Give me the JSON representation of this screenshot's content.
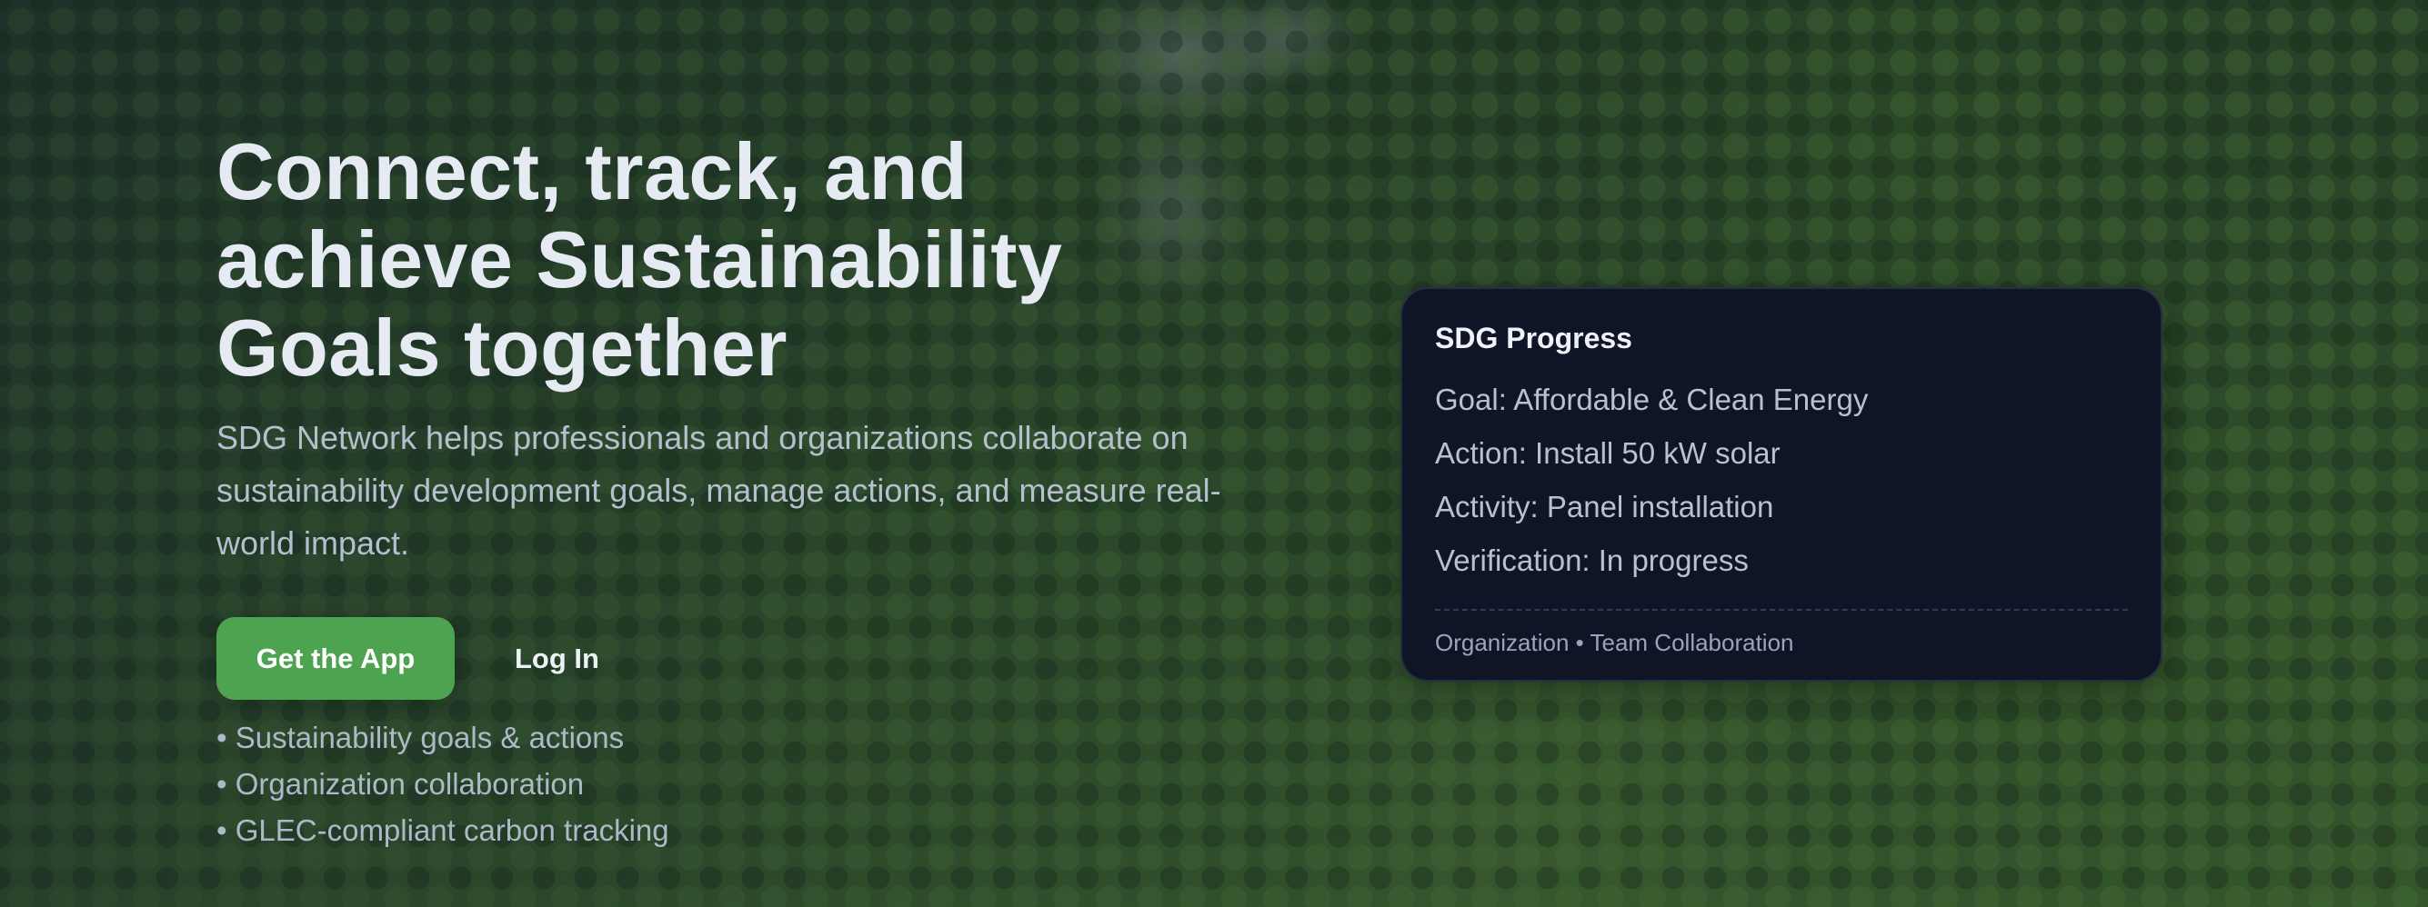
{
  "hero": {
    "headline": "Connect, track, and achieve Sustainability Goals together",
    "description": "SDG Network helps professionals and organizations collaborate on sustainability development goals, manage actions, and measure real-world impact.",
    "primary_button": "Get the App",
    "secondary_button": "Log In",
    "features": [
      "Sustainability goals & actions",
      "Organization collaboration",
      "GLEC-compliant carbon tracking"
    ]
  },
  "card": {
    "title": "SDG Progress",
    "rows": [
      "Goal: Affordable & Clean Energy",
      "Action: Install 50 kW solar",
      "Activity: Panel installation",
      "Verification: In progress"
    ],
    "footer": "Organization • Team Collaboration"
  },
  "colors": {
    "accent": "#4ea351",
    "card_background": "#0f1527",
    "headline": "#e6ebf3"
  }
}
